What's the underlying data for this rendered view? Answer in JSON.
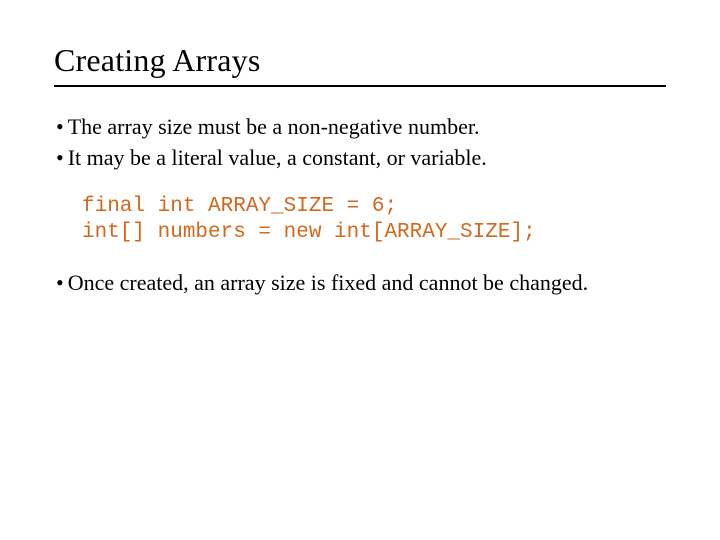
{
  "title": "Creating Arrays",
  "bullets": {
    "b1": "The array size must be a non-negative number.",
    "b2": "It may be a literal value, a constant, or variable.",
    "b3": "Once created, an array size is fixed and cannot be changed."
  },
  "code": {
    "line1": "final int ARRAY_SIZE = 6;",
    "line2": "int[] numbers = new int[ARRAY_SIZE];"
  },
  "bullet_glyph": "•"
}
